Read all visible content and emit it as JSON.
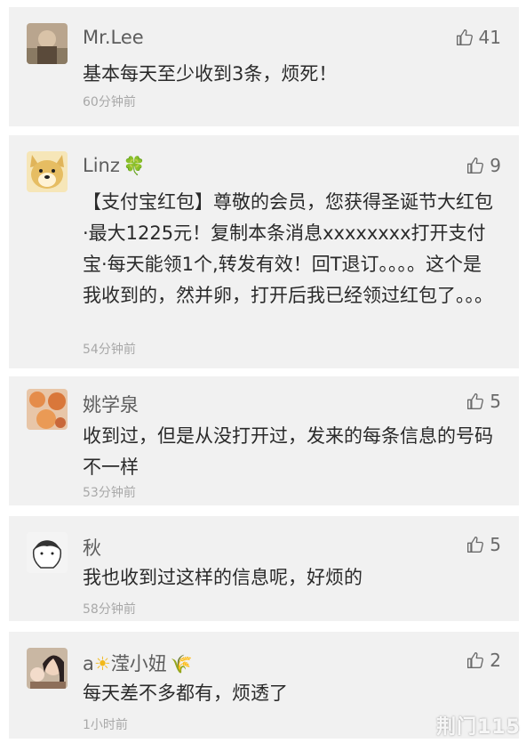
{
  "comments": [
    {
      "name": "Mr.Lee",
      "name_emoji": "",
      "likes": "41",
      "text": "基本每天至少收到3条，烦死！",
      "time": "60分钟前"
    },
    {
      "name": "Linz",
      "name_emoji": "🍀",
      "likes": "9",
      "text": "【支付宝红包】尊敬的会员，您获得圣诞节大红包·最大1225元！复制本条消息xxxxxxxx打开支付宝·每天能领1个,转发有效！回T退订。。。。这个是我收到的，然并卵，打开后我已经领过红包了。。。",
      "time": "54分钟前"
    },
    {
      "name": "姚学泉",
      "name_emoji": "",
      "likes": "5",
      "text": "收到过，但是从没打开过，发来的每条信息的号码不一样",
      "time": "53分钟前"
    },
    {
      "name": "秋",
      "name_emoji": "",
      "likes": "5",
      "text": "我也收到过这样的信息呢，好烦的",
      "time": "58分钟前"
    },
    {
      "name_prefix": "a",
      "name_prefix_emoji": "☀",
      "name": "滢小妞",
      "name_emoji": "🌾",
      "likes": "2",
      "text": "每天差不多都有，烦透了",
      "time": "1小时前"
    }
  ],
  "watermark": "荆门115",
  "icons": {
    "like": "thumbs-up-icon"
  }
}
